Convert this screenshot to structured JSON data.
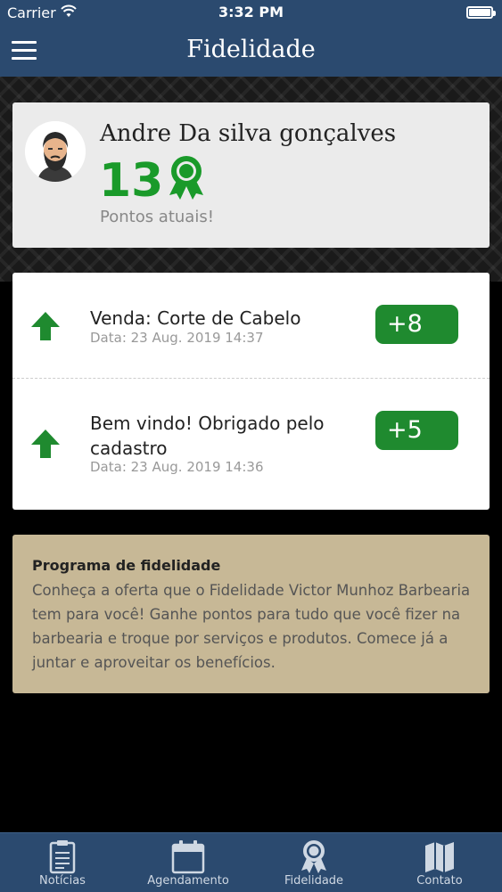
{
  "status": {
    "carrier": "Carrier",
    "time": "3:32 PM"
  },
  "header": {
    "title": "Fidelidade"
  },
  "profile": {
    "name": "Andre Da silva gonçalves",
    "points": "13",
    "points_label": "Pontos atuais!"
  },
  "history": [
    {
      "title": "Venda: Corte de Cabelo",
      "date": "Data: 23 Aug. 2019 14:37",
      "points": "+8"
    },
    {
      "title": "Bem vindo! Obrigado pelo cadastro",
      "date": "Data: 23 Aug. 2019 14:36",
      "points": "+5"
    }
  ],
  "promo": {
    "title": "Programa de fidelidade",
    "text": "Conheça a oferta que o Fidelidade Victor Munhoz Barbearia tem para você! Ganhe pontos para tudo que você fizer na barbearia e troque por serviços e produtos. Comece já a juntar e aproveitar os benefícios."
  },
  "tabs": [
    {
      "label": "Notícias",
      "icon": "clipboard-icon"
    },
    {
      "label": "Agendamento",
      "icon": "calendar-icon"
    },
    {
      "label": "Fidelidade",
      "icon": "ribbon-icon"
    },
    {
      "label": "Contato",
      "icon": "map-icon"
    }
  ],
  "colors": {
    "navbar": "#2b4a6f",
    "points_green": "#1a9a2a",
    "badge_green": "#1f8a2f",
    "promo_bg": "#c7b896"
  }
}
